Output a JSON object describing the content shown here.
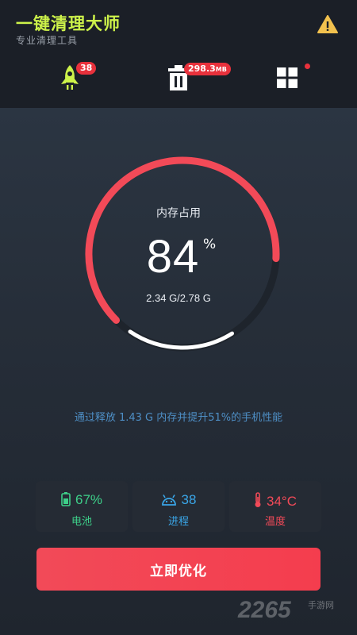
{
  "app": {
    "title": "一键清理大师",
    "subtitle": "专业清理工具",
    "warning_icon": "warning-triangle-icon"
  },
  "toolbar": {
    "boost": {
      "icon": "rocket-icon",
      "badge": "38",
      "color": "#cdf24a"
    },
    "trash": {
      "icon": "trash-icon",
      "badge_value": "298.3",
      "badge_unit": "MB"
    },
    "apps": {
      "icon": "grid-icon",
      "has_dot": true
    }
  },
  "gauge": {
    "title": "内存占用",
    "percent": 84,
    "percent_value": "84",
    "unit": "%",
    "detail": "2.34 G/2.78 G",
    "fill_color": "#f24a58"
  },
  "hint": "通过释放 1.43 G 内存并提升51%的手机性能",
  "stats": [
    {
      "icon": "battery-icon",
      "value": "67%",
      "label": "电池",
      "color": "#3ed08a"
    },
    {
      "icon": "android-icon",
      "value": "38",
      "label": "进程",
      "color": "#3aa6e8"
    },
    {
      "icon": "thermometer-icon",
      "value": "34°C",
      "label": "温度",
      "color": "#f24a58"
    }
  ],
  "action": {
    "label": "立即优化"
  },
  "watermark": {
    "text": "2265",
    "sub": "手游网"
  }
}
